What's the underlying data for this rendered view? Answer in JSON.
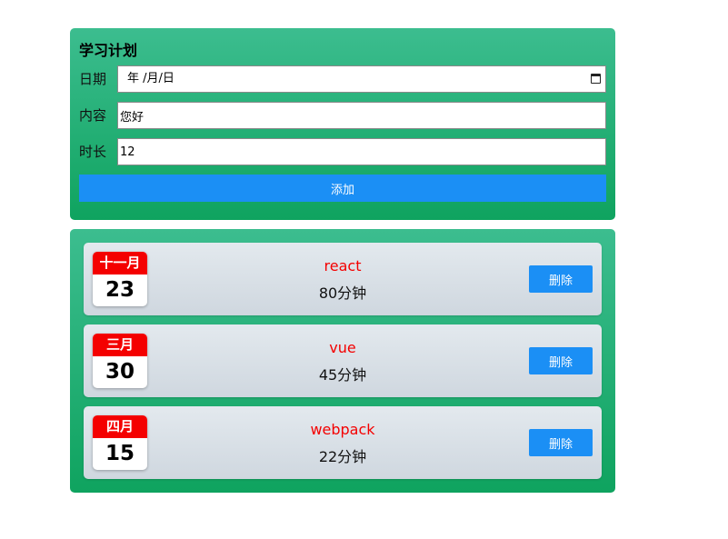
{
  "form": {
    "title": "学习计划",
    "date_label": "日期",
    "date_value": "年 /月/日",
    "content_label": "内容",
    "content_value": "您好",
    "duration_label": "时长",
    "duration_value": "12",
    "add_label": "添加"
  },
  "items": [
    {
      "month": "十一月",
      "day": "23",
      "title": "react",
      "duration": "80分钟",
      "delete_label": "删除"
    },
    {
      "month": "三月",
      "day": "30",
      "title": "vue",
      "duration": "45分钟",
      "delete_label": "删除"
    },
    {
      "month": "四月",
      "day": "15",
      "title": "webpack",
      "duration": "22分钟",
      "delete_label": "删除"
    }
  ],
  "colors": {
    "panel_top": "#3cbd8f",
    "panel_bottom": "#0fa35f",
    "button": "#1b8ff5",
    "calendar_red": "#f40000"
  }
}
